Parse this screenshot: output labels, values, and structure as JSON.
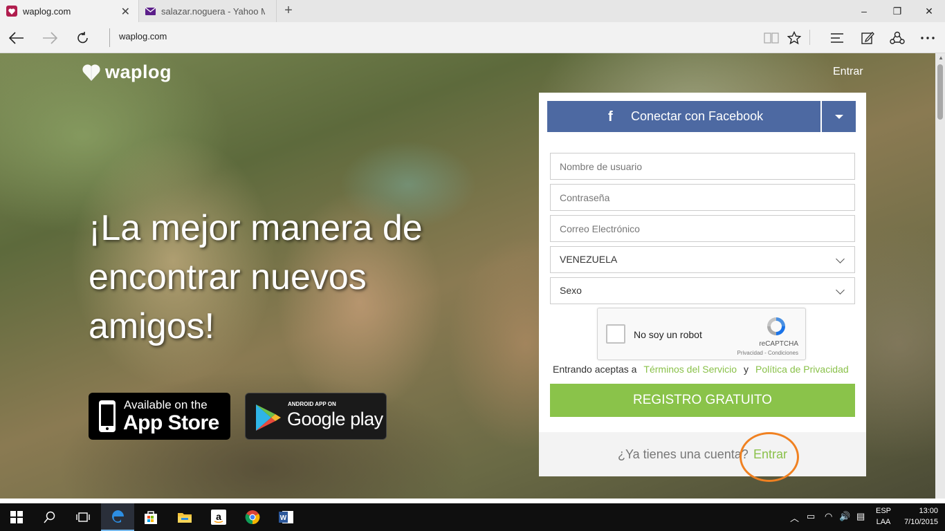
{
  "browser": {
    "tabs": [
      {
        "label": "waplog.com",
        "active": true
      },
      {
        "label": "salazar.noguera - Yahoo Mai",
        "active": false
      }
    ],
    "new_tab_symbol": "+",
    "address": "waplog.com",
    "window_controls": {
      "minimize": "–",
      "restore": "❐",
      "close": "✕"
    }
  },
  "site": {
    "logo_text": "waplog",
    "header_login": "Entrar",
    "hero_lines": [
      "¡La mejor manera de",
      "encontrar nuevos",
      "amigos!"
    ],
    "appstore": {
      "small": "Available on the",
      "big": "App Store"
    },
    "googleplay": {
      "small": "ANDROID APP ON",
      "big": "Google play"
    }
  },
  "signup": {
    "facebook_icon": "f",
    "facebook_label": "Conectar con Facebook",
    "username_placeholder": "Nombre de usuario",
    "password_placeholder": "Contraseña",
    "email_placeholder": "Correo Electrónico",
    "country_value": "VENEZUELA",
    "sex_value": "Sexo",
    "captcha_label": "No soy un robot",
    "captcha_brand": "reCAPTCHA",
    "captcha_links": "Privacidad - Condiciones",
    "terms_prefix": "Entrando aceptas a",
    "terms_link": "Términos del Servicio",
    "terms_and": "y",
    "privacy_link": "Política de Privacidad",
    "register_label": "REGISTRO GRATUITO",
    "have_account": "¿Ya tienes una cuenta?",
    "login_link": "Entrar",
    "accent_color": "#8ac34a",
    "facebook_color": "#4d69a2",
    "annotation_color": "#f08121"
  },
  "taskbar": {
    "lang_top": "ESP",
    "lang_bottom": "LAA",
    "time": "13:00",
    "date": "7/10/2015"
  }
}
